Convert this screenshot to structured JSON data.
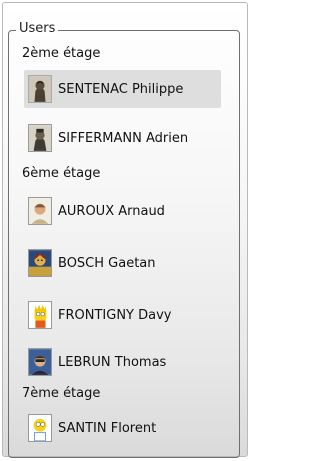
{
  "panel": {
    "legend": "Users",
    "groups": [
      {
        "header": "2ème étage",
        "users": [
          {
            "name": "SENTENAC Philippe",
            "selected": true,
            "avatar": "statue-icon"
          },
          {
            "name": "SIFFERMANN Adrien",
            "selected": false,
            "avatar": "statue-icon"
          }
        ]
      },
      {
        "header": "6ème étage",
        "users": [
          {
            "name": "AUROUX Arnaud",
            "selected": false,
            "avatar": "photo-avatar-icon"
          },
          {
            "name": "BOSCH Gaetan",
            "selected": false,
            "avatar": "painting-avatar-icon"
          },
          {
            "name": "FRONTIGNY Davy",
            "selected": false,
            "avatar": "cartoon-avatar-icon"
          },
          {
            "name": "LEBRUN Thomas",
            "selected": false,
            "avatar": "photo-avatar-icon"
          }
        ]
      },
      {
        "header": "7ème étage",
        "users": [
          {
            "name": "SANTIN Florent",
            "selected": false,
            "avatar": "cartoon-avatar-icon"
          }
        ]
      }
    ]
  }
}
